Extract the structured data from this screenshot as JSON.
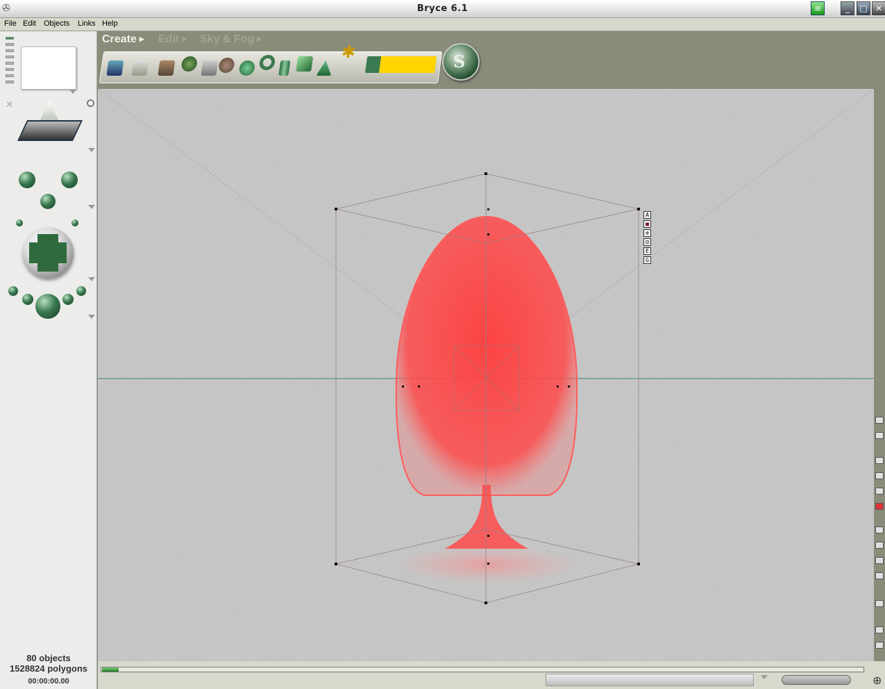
{
  "window": {
    "title": "Bryce 6.1"
  },
  "menu": {
    "items": [
      "File",
      "Edit",
      "Objects",
      "Links",
      "Help"
    ]
  },
  "tabs": [
    {
      "label": "Create"
    },
    {
      "label": "Edit"
    },
    {
      "label": "Sky & Fog"
    }
  ],
  "create_palette": {
    "icons": [
      "water-plane-icon",
      "terrain-plane-icon",
      "terrain-icon",
      "tree-icon",
      "stone-tree-icon",
      "rock-icon",
      "torus-icon",
      "cylinder-icon",
      "cube-icon",
      "cone-icon",
      "figure-icon",
      "primitive-shapes-icon"
    ]
  },
  "status": {
    "objects": "80 objects",
    "polygons": "1528824 polygons",
    "time": "00:00:00.00"
  },
  "object_tags": [
    "A",
    "■",
    "⊕",
    "⊡",
    "E",
    "G"
  ],
  "colors": {
    "selected_object": "#ff3c3c",
    "horizon_line": "#3a8a6a",
    "accent_green": "#2e7a40"
  }
}
